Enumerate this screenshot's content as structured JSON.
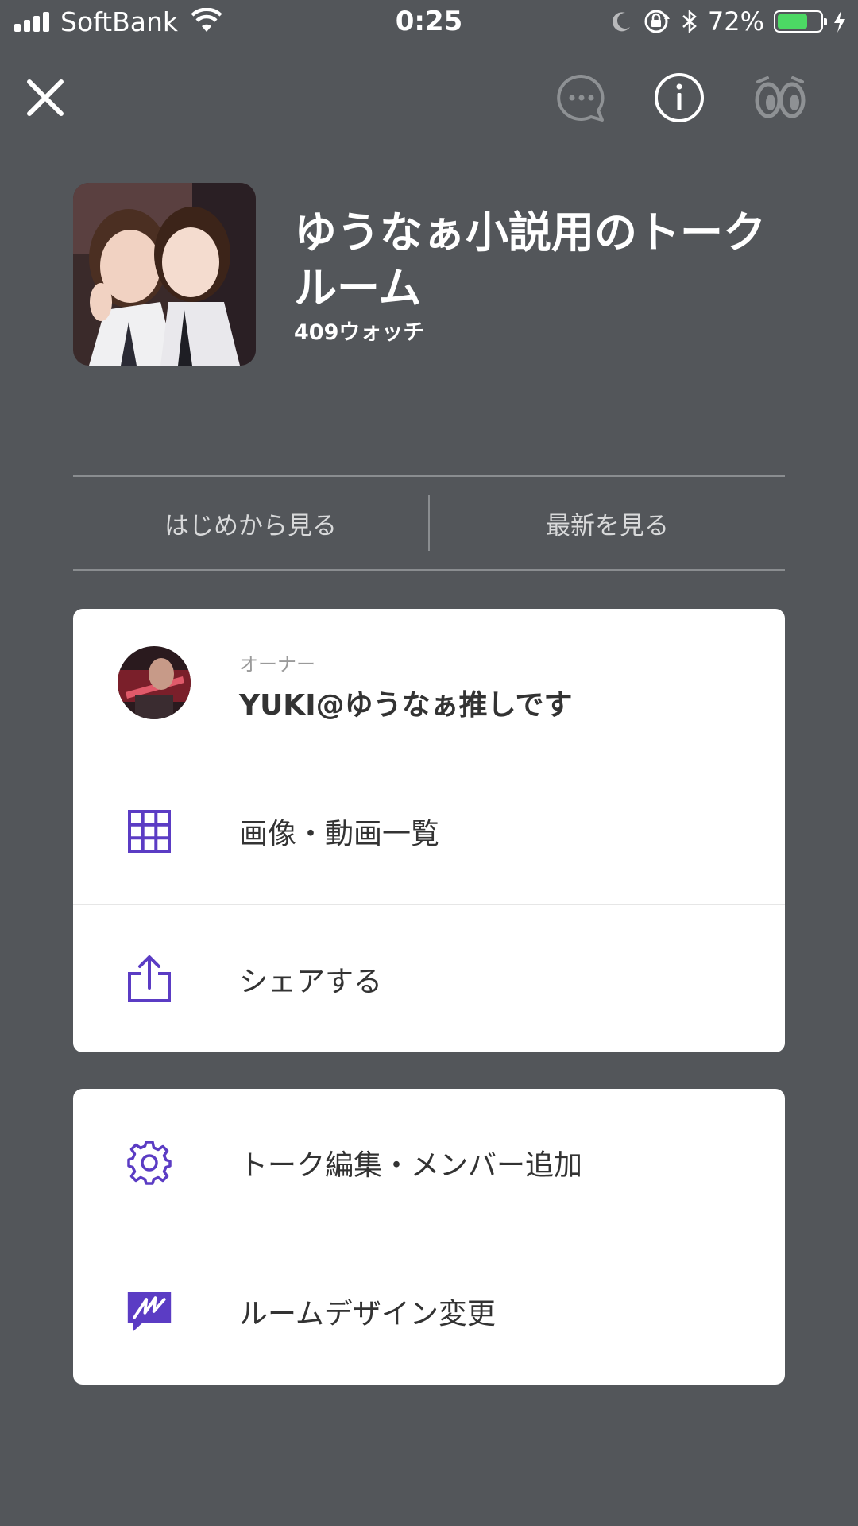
{
  "status_bar": {
    "carrier": "SoftBank",
    "time": "0:25",
    "battery_percent": "72%",
    "battery_level": 0.72,
    "icons": [
      "signal-icon",
      "wifi-icon",
      "moon-icon",
      "orientation-lock-icon",
      "bluetooth-icon",
      "battery-icon",
      "charging-icon"
    ]
  },
  "top_nav": {
    "icons": [
      "close-icon",
      "chat-bubble-icon",
      "info-icon",
      "watch-eyes-icon"
    ]
  },
  "header": {
    "title": "ゆうなぁ小説用のトークルーム",
    "watch_count": "409ウォッチ"
  },
  "view_buttons": {
    "from_start": "はじめから見る",
    "latest": "最新を見る"
  },
  "card1": {
    "owner_role": "オーナー",
    "owner_name": "YUKI@ゆうなぁ推しです",
    "media_list": "画像・動画一覧",
    "share": "シェアする"
  },
  "card2": {
    "edit_talk": "トーク編集・メンバー追加",
    "room_design": "ルームデザイン変更"
  },
  "colors": {
    "background": "#53565a",
    "accent_purple": "#5b3cc4",
    "battery_green": "#4cd964"
  }
}
